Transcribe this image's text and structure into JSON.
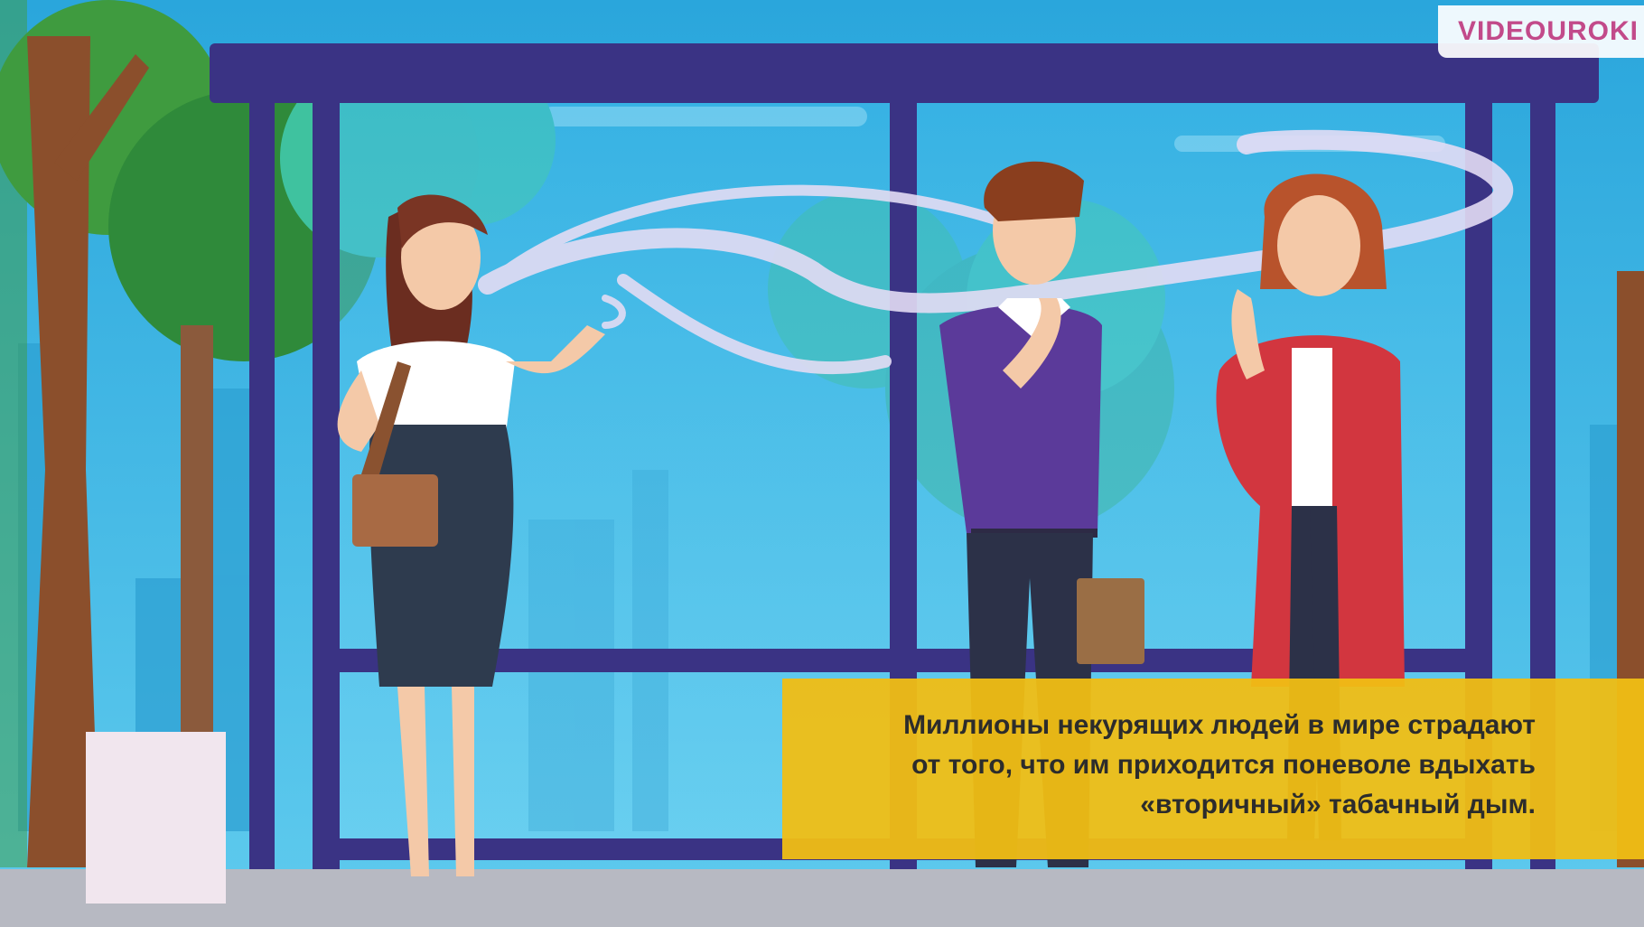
{
  "scene": {
    "colors": {
      "sky": "#38b7e3",
      "shelter_frame": "#3a3384",
      "ground": "#b7b9c2",
      "caption_bg": "#f0be14",
      "caption_text": "#2c2c2c",
      "logo_text": "#c24a8a"
    }
  },
  "logo": {
    "text": "VIDEOUROKI"
  },
  "caption": {
    "line1": "Миллионы некурящих людей в мире страдают",
    "line2": "от того, что им приходится поневоле вдыхать",
    "line3": "«вторичный» табачный дым."
  }
}
